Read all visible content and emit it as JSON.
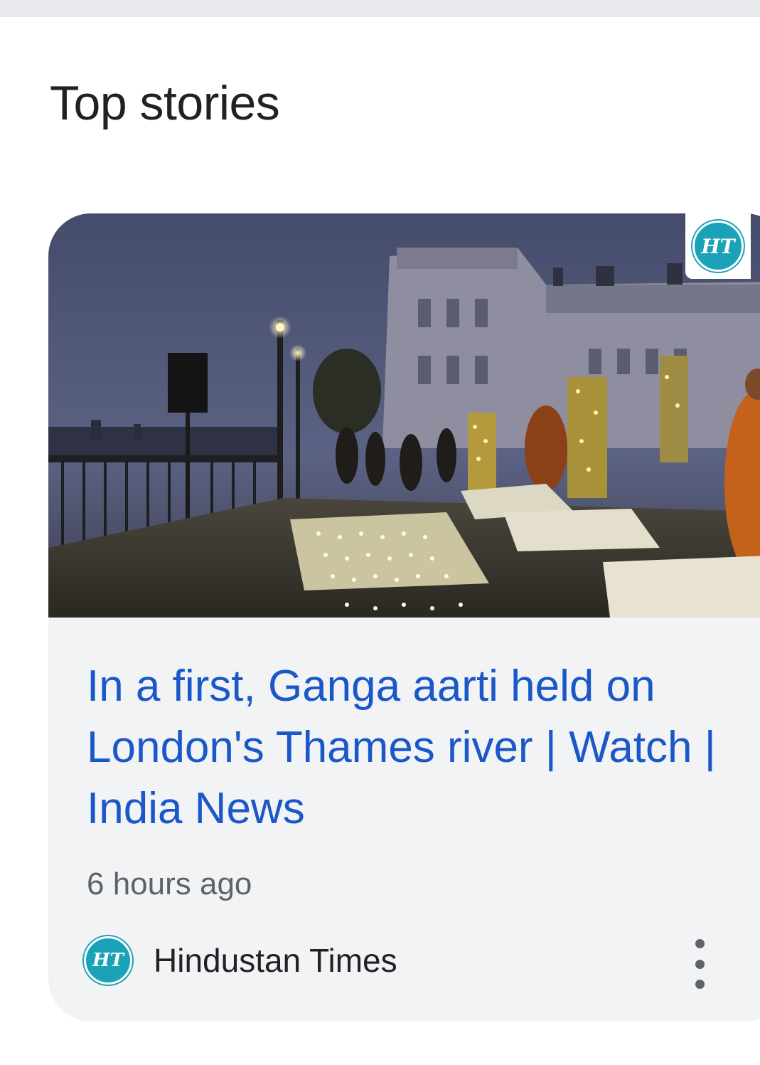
{
  "section": {
    "title": "Top stories"
  },
  "story": {
    "publisher_logo_text": "HT",
    "headline": "In a first, Ganga aarti held on London's Thames river | Watch | India News",
    "timestamp": "6 hours ago",
    "source_name": "Hindustan Times",
    "source_logo_text": "HT",
    "logo_color": "#1aa3b8",
    "headline_color": "#1a57c9",
    "icons": {
      "more": "more-vert-icon",
      "logo": "hindustan-times-logo"
    }
  }
}
